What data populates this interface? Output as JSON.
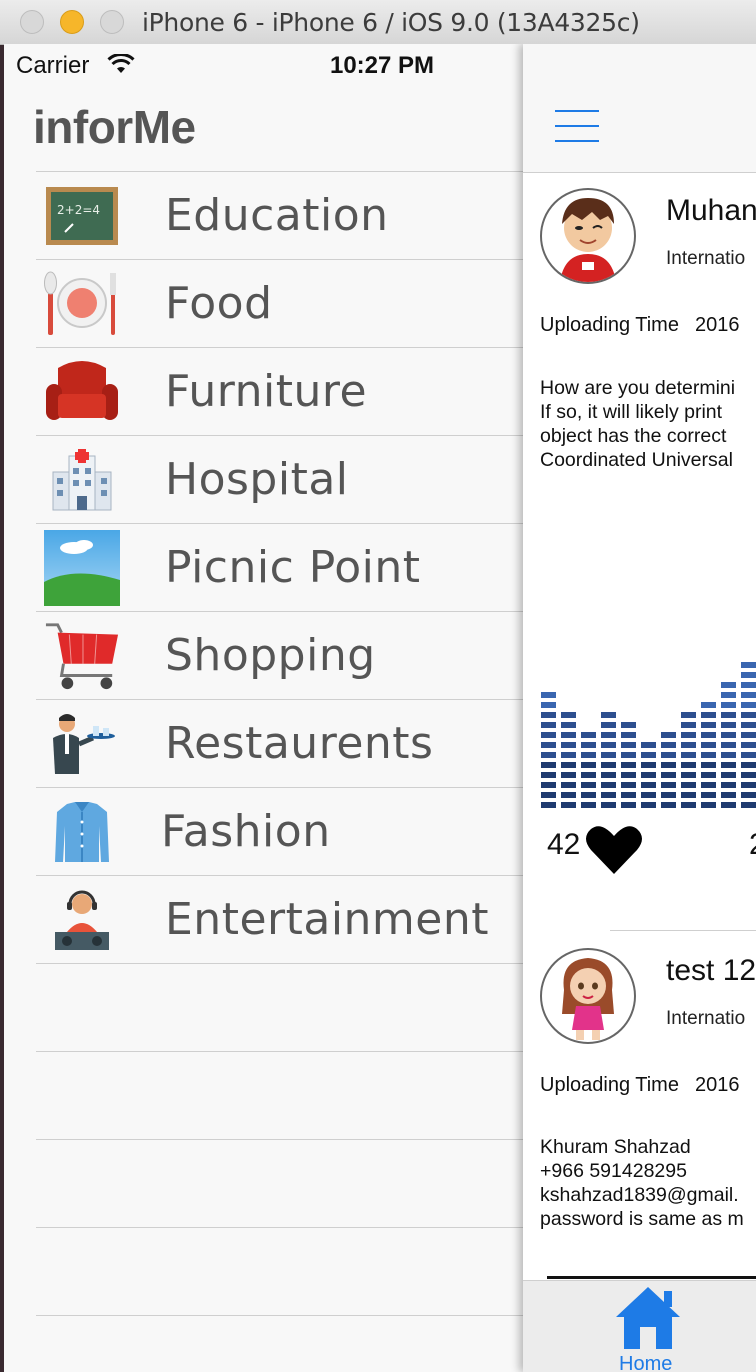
{
  "window": {
    "title": "iPhone 6 - iPhone 6 / iOS 9.0 (13A4325c)"
  },
  "status_bar": {
    "carrier": "Carrier",
    "time": "10:27 PM"
  },
  "app": {
    "title": "inforMe"
  },
  "menu": {
    "items": [
      {
        "label": "Education",
        "icon": "chalkboard-icon"
      },
      {
        "label": "Food",
        "icon": "plate-cutlery-icon"
      },
      {
        "label": "Furniture",
        "icon": "armchair-icon"
      },
      {
        "label": "Hospital",
        "icon": "hospital-icon"
      },
      {
        "label": "Picnic Point",
        "icon": "landscape-icon"
      },
      {
        "label": "Shopping",
        "icon": "shopping-cart-icon"
      },
      {
        "label": "Restaurents",
        "icon": "waiter-icon"
      },
      {
        "label": "Fashion",
        "icon": "shirt-icon"
      },
      {
        "label": "Entertainment",
        "icon": "dj-icon"
      }
    ]
  },
  "posts": [
    {
      "name": "Muhan",
      "subtitle": "Internatio",
      "upload_label": "Uploading Time",
      "upload_date": "2016",
      "body": [
        "How are you determini",
        "If so, it will likely print",
        "object has the correct",
        "Coordinated Universal"
      ],
      "likes": "42",
      "likes_partial": "2"
    },
    {
      "name": "test 12",
      "subtitle": "Internatio",
      "upload_label": "Uploading Time",
      "upload_date": "2016",
      "body": [
        "Khuram Shahzad",
        "+966 591428295",
        "kshahzad1839@gmail.",
        "password is same as m"
      ]
    }
  ],
  "tabbar": {
    "home_label": "Home"
  },
  "colors": {
    "accent": "#1e7be6",
    "menu_text": "#555555"
  }
}
